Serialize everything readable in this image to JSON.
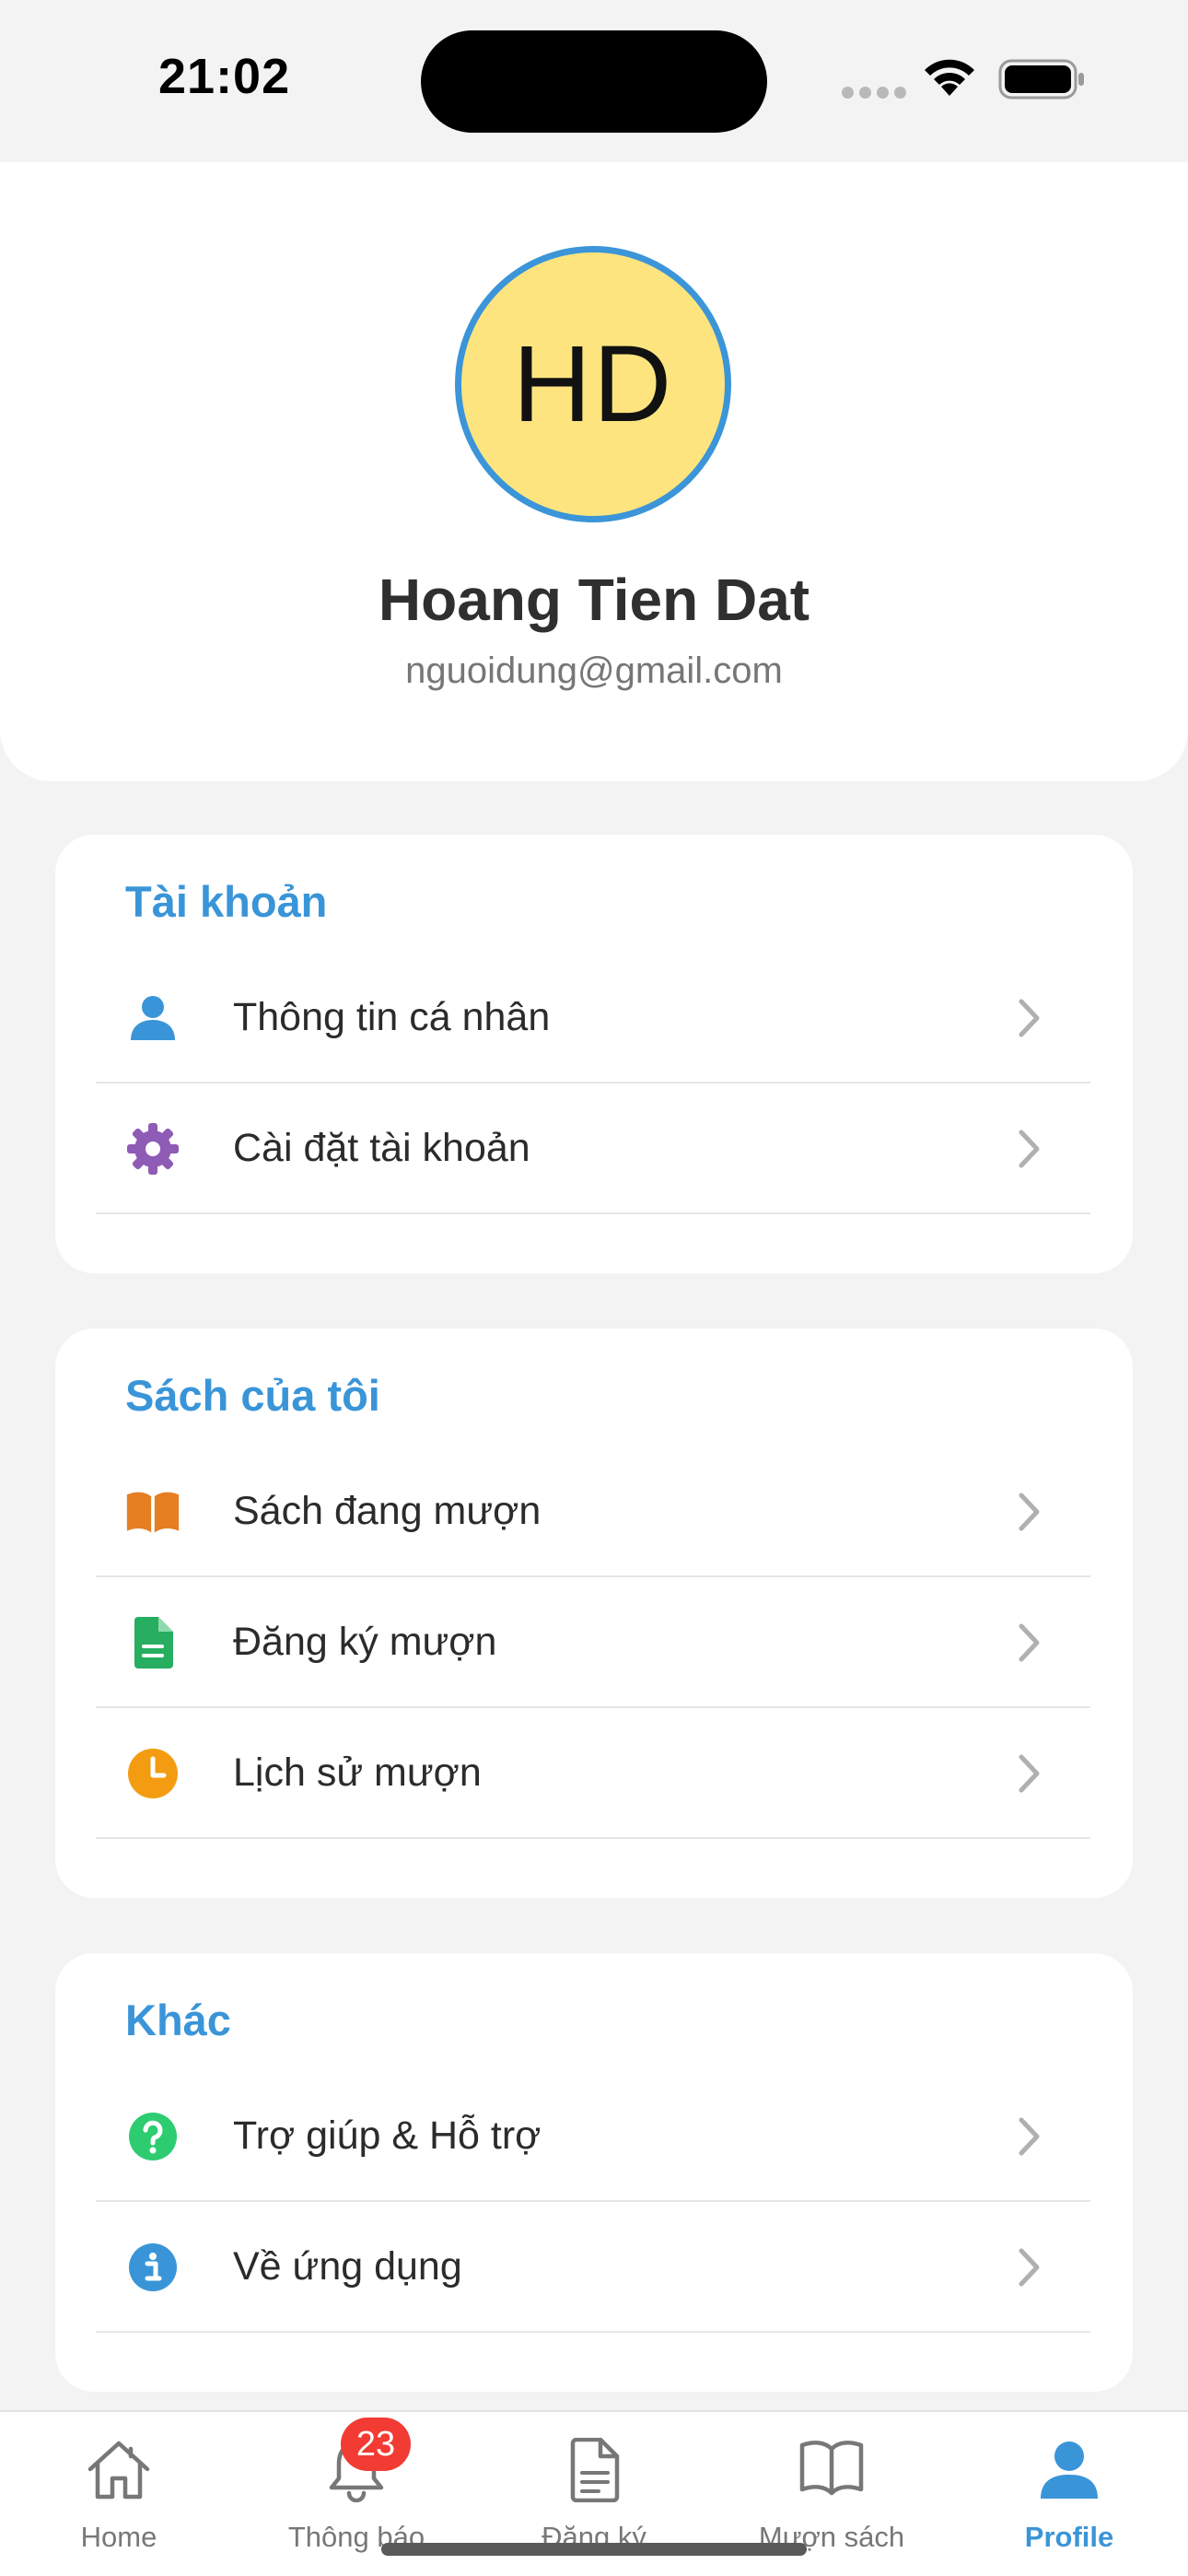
{
  "status_bar": {
    "time": "21:02"
  },
  "profile": {
    "initials": "HD",
    "name": "Hoang Tien Dat",
    "email": "nguoidung@gmail.com"
  },
  "sections": [
    {
      "title": "Tài khoản",
      "items": [
        {
          "label": "Thông tin cá nhân",
          "icon": "person-icon",
          "color": "#3a95d8"
        },
        {
          "label": "Cài đặt tài khoản",
          "icon": "gear-icon",
          "color": "#8e5bb5"
        }
      ]
    },
    {
      "title": "Sách của tôi",
      "items": [
        {
          "label": "Sách đang mượn",
          "icon": "open-book-icon",
          "color": "#e67e22"
        },
        {
          "label": "Đăng ký mượn",
          "icon": "document-icon",
          "color": "#27ae60"
        },
        {
          "label": "Lịch sử mượn",
          "icon": "clock-icon",
          "color": "#f39c12"
        }
      ]
    },
    {
      "title": "Khác",
      "items": [
        {
          "label": "Trợ giúp & Hỗ trợ",
          "icon": "help-icon",
          "color": "#2ecc71"
        },
        {
          "label": "Về ứng dụng",
          "icon": "info-icon",
          "color": "#3a95d8"
        }
      ]
    }
  ],
  "bottom_nav": {
    "items": [
      {
        "label": "Home",
        "icon": "home-icon"
      },
      {
        "label": "Thông báo",
        "icon": "bell-icon",
        "badge": "23"
      },
      {
        "label": "Đăng ký",
        "icon": "document-icon"
      },
      {
        "label": "Mượn sách",
        "icon": "book-icon"
      },
      {
        "label": "Profile",
        "icon": "person-icon",
        "active": true
      }
    ]
  },
  "colors": {
    "accent": "#3a95d8",
    "avatar_bg": "#fde47f",
    "badge": "#f23b33"
  }
}
